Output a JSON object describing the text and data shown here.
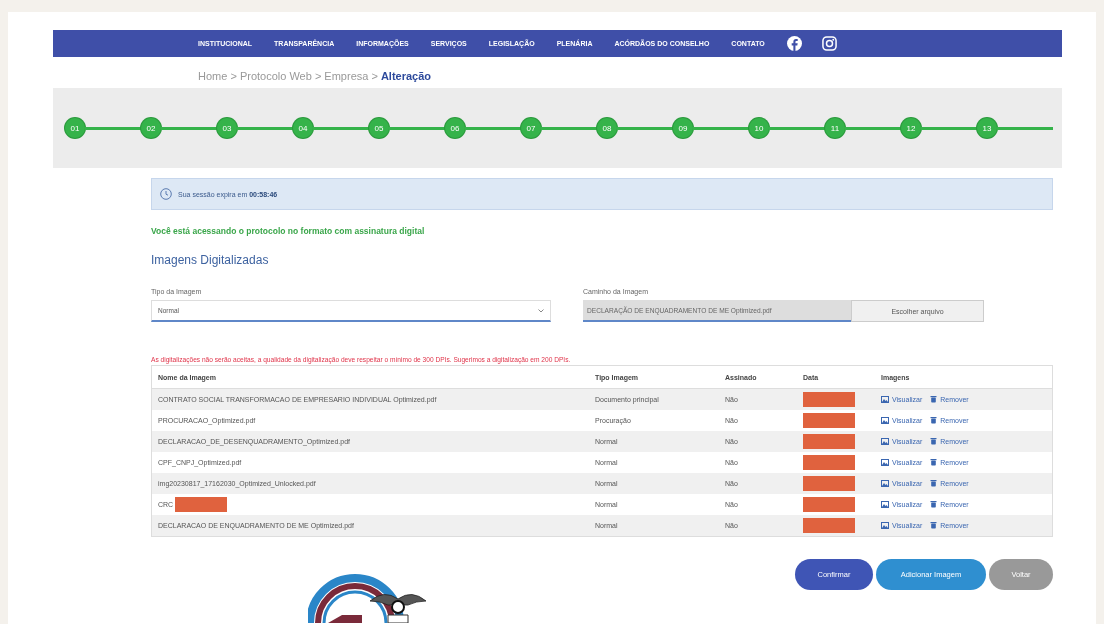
{
  "nav": {
    "items": [
      "INSTITUCIONAL",
      "TRANSPARÊNCIA",
      "INFORMAÇÕES",
      "SERVIÇOS",
      "LEGISLAÇÃO",
      "PLENÁRIA",
      "ACÓRDÃOS DO CONSELHO",
      "CONTATO"
    ]
  },
  "breadcrumb": "Home > Protocolo Web > Empresa > **Alteração**",
  "steps": [
    {
      "label": "01",
      "completed": true
    },
    {
      "label": "02",
      "completed": true
    },
    {
      "label": "03",
      "completed": true
    },
    {
      "label": "04",
      "completed": true
    },
    {
      "label": "05",
      "completed": true
    },
    {
      "label": "06",
      "completed": true
    },
    {
      "label": "07",
      "completed": true
    },
    {
      "label": "08",
      "completed": true
    },
    {
      "label": "09",
      "completed": true
    },
    {
      "label": "10",
      "completed": true
    },
    {
      "label": "11",
      "completed": true
    },
    {
      "label": "12",
      "completed": true
    },
    {
      "label": "13",
      "completed": true
    }
  ],
  "session": "Sua sessão expira em **00:58:46**",
  "notice": "Você está acessando o protocolo no formato com assinatura digital",
  "section_title": "Imagens Digitalizadas",
  "form": {
    "type_label": "Tipo da Imagem",
    "type_value": "Normal",
    "path_label": "Caminho da Imagem",
    "path_value": "DECLARAÇÃO DE ENQUADRAMENTO DE ME Optimized.pdf",
    "choose_button": "Escolher arquivo"
  },
  "warning": "As digitalizações não serão aceitas, a qualidade da digitalização deve respeitar o mínimo de 300 DPIs. Sugerimos a digitalização em 200 DPIs.",
  "table": {
    "columns": [
      "Nome da Imagem",
      "Tipo Imagem",
      "Assinado",
      "Data",
      "Imagens"
    ],
    "rows": [
      {
        "name": "CONTRATO SOCIAL TRANSFORMACAO DE EMPRESARIO INDIVIDUAL Optimized.pdf",
        "name_redacted": false,
        "type": "Documento principal",
        "signed": "Não",
        "view": "Visualizar",
        "remove": "Remover"
      },
      {
        "name": "PROCURACAO_Optimized.pdf",
        "name_redacted": false,
        "type": "Procuração",
        "signed": "Não",
        "view": "Visualizar",
        "remove": "Remover"
      },
      {
        "name": "DECLARACAO_DE_DESENQUADRAMENTO_Optimized.pdf",
        "name_redacted": false,
        "type": "Normal",
        "signed": "Não",
        "view": "Visualizar",
        "remove": "Remover"
      },
      {
        "name": "CPF_CNPJ_Optimized.pdf",
        "name_redacted": false,
        "type": "Normal",
        "signed": "Não",
        "view": "Visualizar",
        "remove": "Remover"
      },
      {
        "name": "img20230817_17162030_Optimized_Unlocked.pdf",
        "name_redacted": false,
        "type": "Normal",
        "signed": "Não",
        "view": "Visualizar",
        "remove": "Remover"
      },
      {
        "name": "CRC",
        "name_redacted": true,
        "type": "Normal",
        "signed": "Não",
        "view": "Visualizar",
        "remove": "Remover"
      },
      {
        "name": "DECLARACAO DE ENQUADRAMENTO DE ME Optimized.pdf",
        "name_redacted": false,
        "type": "Normal",
        "signed": "Não",
        "view": "Visualizar",
        "remove": "Remover"
      }
    ]
  },
  "buttons": [
    {
      "label": "Confirmar",
      "kind": "primary"
    },
    {
      "label": "Adicionar Imagem",
      "kind": "info"
    },
    {
      "label": "Voltar",
      "kind": "secondary"
    }
  ]
}
